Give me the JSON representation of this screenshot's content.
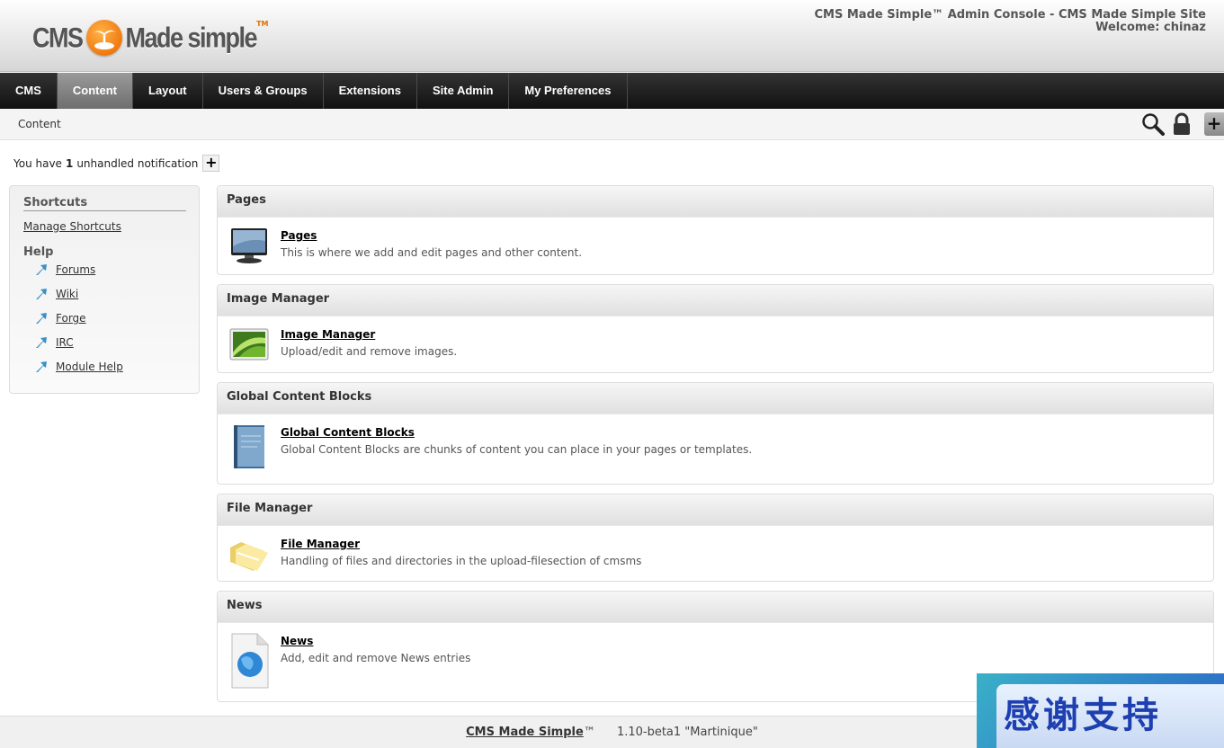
{
  "header": {
    "logo_left": "CMS",
    "logo_right": "Made simple",
    "logo_tm": "TM",
    "site_title": "CMS Made Simple™ Admin Console - CMS Made Simple Site",
    "welcome": "Welcome: chinaz"
  },
  "nav": {
    "items": [
      "CMS",
      "Content",
      "Layout",
      "Users & Groups",
      "Extensions",
      "Site Admin",
      "My Preferences"
    ],
    "active": "Content"
  },
  "breadcrumb": "Content",
  "toolbar": {
    "add_label": "+"
  },
  "notification": {
    "prefix": "You have",
    "count": "1",
    "suffix": "unhandled notification",
    "expand_label": "+"
  },
  "sidebar": {
    "title": "Shortcuts",
    "manage": "Manage Shortcuts",
    "help_title": "Help",
    "help_links": [
      "Forums",
      "Wiki",
      "Forge",
      "IRC",
      "Module Help"
    ]
  },
  "sections": [
    {
      "heading": "Pages",
      "link": "Pages",
      "description": "This is where we add and edit pages and other content.",
      "icon": "monitor-icon"
    },
    {
      "heading": "Image Manager",
      "link": "Image Manager",
      "description": "Upload/edit and remove images.",
      "icon": "image-icon"
    },
    {
      "heading": "Global Content Blocks",
      "link": "Global Content Blocks",
      "description": "Global Content Blocks are chunks of content you can place in your pages or templates.",
      "icon": "book-icon"
    },
    {
      "heading": "File Manager",
      "link": "File Manager",
      "description": "Handling of files and directories in the upload-filesection of cmsms",
      "icon": "folder-icon"
    },
    {
      "heading": "News",
      "link": "News",
      "description": "Add, edit and remove News entries",
      "icon": "news-globe-icon"
    }
  ],
  "footer": {
    "brand": "CMS Made Simple",
    "tm": "™",
    "version": "1.10-beta1  \"Martinique\""
  },
  "badge": "感谢支持"
}
